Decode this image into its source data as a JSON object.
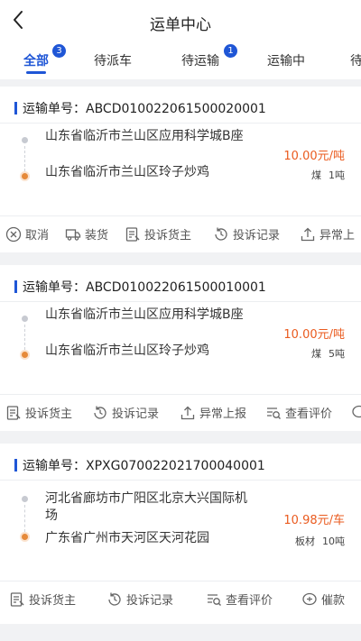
{
  "header": {
    "title": "运单中心"
  },
  "tabs": [
    {
      "label": "全部",
      "badge": "3"
    },
    {
      "label": "待派车"
    },
    {
      "label": "待运输",
      "badge": "1"
    },
    {
      "label": "运输中"
    },
    {
      "label": "待"
    }
  ],
  "orders": [
    {
      "order_label": "运输单号：ABCD010022061500020001",
      "from": "山东省临沂市兰山区应用科学城B座",
      "to": "山东省临沂市兰山区玲子炒鸡",
      "price": "10.00元/吨",
      "cargo": "煤",
      "weight": "1吨",
      "actions": [
        "取消",
        "装货",
        "投诉货主",
        "投诉记录",
        "异常上"
      ]
    },
    {
      "order_label": "运输单号：ABCD010022061500010001",
      "from": "山东省临沂市兰山区应用科学城B座",
      "to": "山东省临沂市兰山区玲子炒鸡",
      "price": "10.00元/吨",
      "cargo": "煤",
      "weight": "5吨",
      "actions": [
        "投诉货主",
        "投诉记录",
        "异常上报",
        "查看评价"
      ]
    },
    {
      "order_label": "运输单号：XPXG070022021700040001",
      "from": "河北省廊坊市广阳区北京大兴国际机场",
      "to": "广东省广州市天河区天河花园",
      "price": "10.98元/车",
      "cargo": "板材",
      "weight": "10吨",
      "actions": [
        "投诉货主",
        "投诉记录",
        "查看评价",
        "催款"
      ]
    }
  ],
  "colors": {
    "accent": "#1f56d6",
    "price": "#ea5b1f",
    "background": "#f1f2f4"
  },
  "icons": [
    "back-icon",
    "cancel-icon",
    "truck-icon",
    "complaint-icon",
    "history-icon",
    "upload-icon",
    "review-icon",
    "urge-icon"
  ]
}
